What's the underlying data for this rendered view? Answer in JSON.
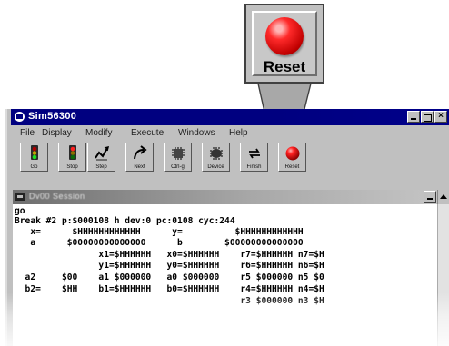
{
  "window": {
    "title": "Sim56300"
  },
  "menu": [
    "File",
    "Display",
    "Modify",
    "Execute",
    "Windows",
    "Help"
  ],
  "toolbar": [
    {
      "label": "Go",
      "icon": "traffic-light-green-icon"
    },
    {
      "label": "Stop",
      "icon": "traffic-light-red-icon"
    },
    {
      "label": "Step",
      "icon": "step-icon"
    },
    {
      "label": "Next",
      "icon": "next-arrow-icon"
    },
    {
      "label": "Ctrl-g",
      "icon": "dsp-chip-icon"
    },
    {
      "label": "Device",
      "icon": "device-chip-icon"
    },
    {
      "label": "Finish",
      "icon": "finish-loop-icon"
    },
    {
      "label": "Reset",
      "icon": "reset-led-icon"
    }
  ],
  "callout": {
    "label": "Reset"
  },
  "child": {
    "title": "Dv00 Session"
  },
  "console": [
    "go",
    "Break #2 p:$000108 h dev:0 pc:0108 cyc:244",
    "   x=      $HHHHHHHHHHHH      y=          $HHHHHHHHHHHH",
    "   a      $00000000000000      b        $00000000000000",
    "                x1=$HHHHHH   x0=$HHHHHH    r7=$HHHHHH n7=$H",
    "                y1=$HHHHHH   y0=$HHHHHH    r6=$HHHHHH n6=$H",
    "  a2     $00    a1 $000000   a0 $000000    r5 $000000 n5 $0",
    "  b2=    $HH    b1=$HHHHHH   b0=$HHHHHH    r4=$HHHHHH n4=$H",
    "                                           r3 $000000 n3 $H"
  ],
  "colors": {
    "titlebar": "#000080",
    "led": "#e01010",
    "highlight": "#d00000"
  }
}
